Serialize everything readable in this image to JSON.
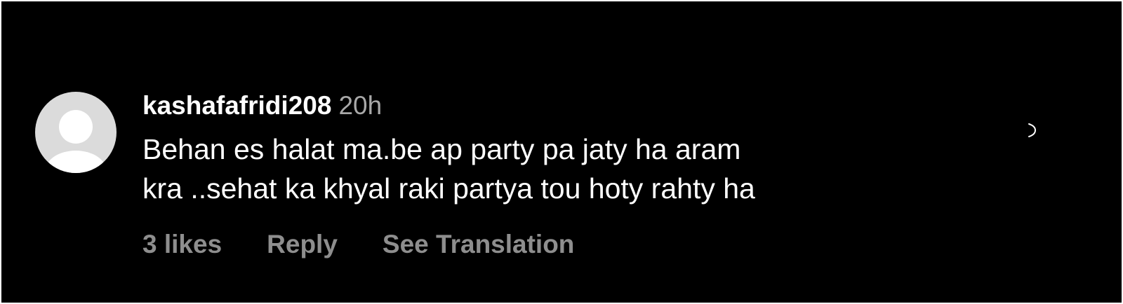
{
  "comment": {
    "username": "kashafafridi208",
    "time": "20h",
    "text_line1": "Behan es halat ma.be ap party pa jaty ha aram",
    "text_line2": "kra ..sehat ka khyal raki partya tou hoty rahty ha",
    "likes": "3 likes",
    "reply_label": "Reply",
    "translation_label": "See Translation",
    "avatar_icon": "default-avatar-icon",
    "like_icon": "heart-outline-icon"
  },
  "colors": {
    "background": "#000000",
    "text_primary": "#ffffff",
    "text_secondary": "#a8a8a8",
    "avatar_bg": "#dbdbdb"
  }
}
